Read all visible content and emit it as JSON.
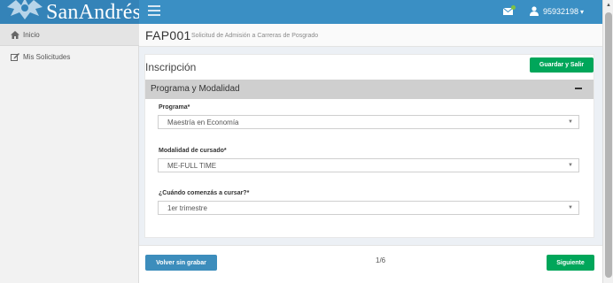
{
  "header": {
    "logo_text": "SanAndrés",
    "user_id": "95932198",
    "user_caret": "▾",
    "mail_icon": "envelope-icon",
    "user_icon": "user-icon"
  },
  "sidebar": {
    "items": [
      {
        "label": "Inicio",
        "icon": "home-icon"
      },
      {
        "label": "Mis Solicitudes",
        "icon": "edit-icon"
      }
    ]
  },
  "page": {
    "code": "FAP001",
    "subtitle": "Solicitud de Admisión a Carreras de Posgrado"
  },
  "form": {
    "title": "Inscripción",
    "save_label": "Guardar y Salir",
    "section_title": "Programa y Modalidad",
    "collapse_symbol": "−",
    "fields": [
      {
        "label": "Programa*",
        "value": "Maestría en Economía"
      },
      {
        "label": "Modalidad de cursado*",
        "value": "ME-FULL TIME"
      },
      {
        "label": "¿Cuándo comenzás a cursar?*",
        "value": "1er trimestre"
      }
    ]
  },
  "footer": {
    "back_label": "Volver sin grabar",
    "pager": "1/6",
    "next_label": "Siguiente"
  },
  "colors": {
    "topbar": "#3a8fc4",
    "green": "#00a65a",
    "blue": "#3c8dbc"
  }
}
